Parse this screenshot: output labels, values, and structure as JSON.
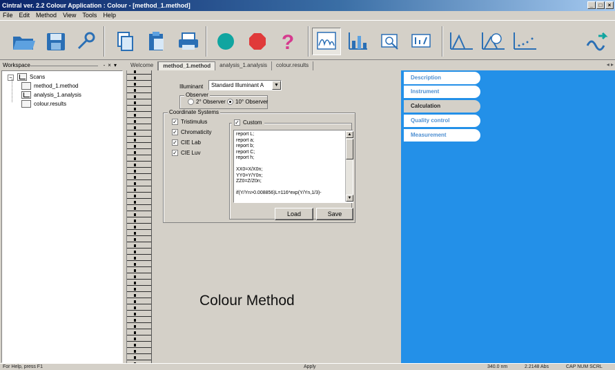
{
  "window": {
    "title": "Cintral ver. 2.2 Colour Application : Colour - [method_1.method]",
    "controls": [
      "_",
      "□",
      "×"
    ]
  },
  "menu": [
    "File",
    "Edit",
    "Method",
    "View",
    "Tools",
    "Help"
  ],
  "toolbar": {
    "buttons": [
      "open-folder-icon",
      "save-disk-icon",
      "tools-icon",
      "copy-icon",
      "paste-icon",
      "print-icon",
      "go-circle-icon",
      "stop-octagon-icon",
      "help-question-icon",
      "spectrum-chart-icon",
      "bar-chart-icon",
      "instrument-icon",
      "measure-icon",
      "peak-chart-icon",
      "gauge-chart-icon",
      "scatter-chart-icon",
      "transfer-icon"
    ]
  },
  "workspace": {
    "title": "Workspace",
    "tree": {
      "root": "Scans",
      "items": [
        "method_1.method",
        "analysis_1.analysis",
        "colour.results"
      ]
    }
  },
  "tabs": [
    "Welcome",
    "method_1.method",
    "analysis_1.analysis",
    "colour.results"
  ],
  "form": {
    "illuminant_label": "Illuminant",
    "illuminant_value": "Standard Illuminant A",
    "observer_title": "Observer",
    "observer_2": "2° Observer",
    "observer_10": "10° Observer",
    "coord_title": "Coordinate Systems",
    "checks": [
      "Tristimulus",
      "Chromaticity",
      "CIE Lab",
      "CIE Luv"
    ],
    "custom_label": "Custom",
    "custom_text": "report L;\nreport a;\nreport b;\nreport C;\nreport h;\n\nXX0=X/X0n;\nYY0=Y/Y0n;\nZZ0=Z/Z0n;\n\nif(Y/Yn>0.008856)L=116*exp(Y/Yn,1/3)-",
    "load_label": "Load",
    "save_label": "Save"
  },
  "side_tabs": [
    "Description",
    "Instrument",
    "Calculation",
    "Quality control",
    "Measurement"
  ],
  "caption": "Colour Method",
  "status": {
    "help": "For Help, press F1",
    "mode": "Apply",
    "wavelength": "340.0 nm",
    "absorbance": "2.2148 Abs",
    "flags": "CAP NUM SCRL"
  },
  "colors": {
    "title_bar": "#0a246a",
    "blue_panel": "#2390e8",
    "side_tab_text": "#4e8fd1"
  }
}
